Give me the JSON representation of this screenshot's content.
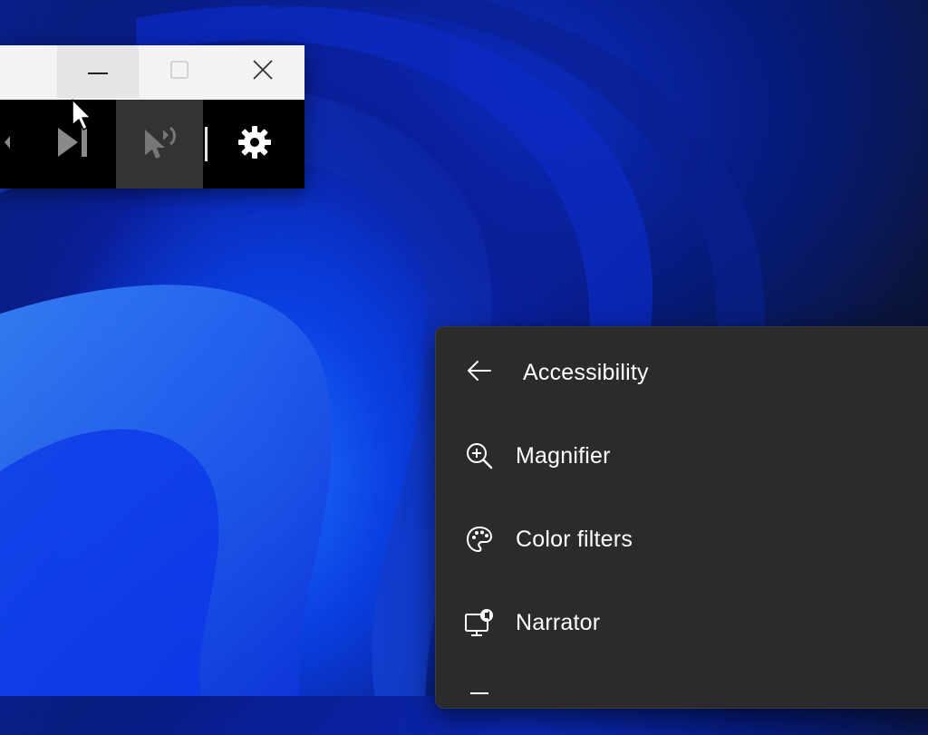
{
  "narrator_toolbar": {
    "title_bar": {
      "minimize_icon": "minimize-icon",
      "maximize_icon": "maximize-icon",
      "close_icon": "close-icon"
    },
    "controls": [
      {
        "icon": "previous-icon"
      },
      {
        "icon": "next-icon"
      },
      {
        "icon": "speak-icon"
      },
      {
        "icon": "gear-icon"
      }
    ]
  },
  "accessibility_flyout": {
    "title": "Accessibility",
    "back_icon": "back-arrow-icon",
    "items": [
      {
        "label": "Magnifier",
        "icon": "magnifier-icon"
      },
      {
        "label": "Color filters",
        "icon": "palette-icon"
      },
      {
        "label": "Narrator",
        "icon": "narrator-icon"
      }
    ]
  },
  "colors": {
    "flyout_bg": "#2b2b2b",
    "toolbar_bg": "#000000",
    "titlebar_bg": "#f3f3f3",
    "wallpaper_accent": "#1e6dff"
  }
}
